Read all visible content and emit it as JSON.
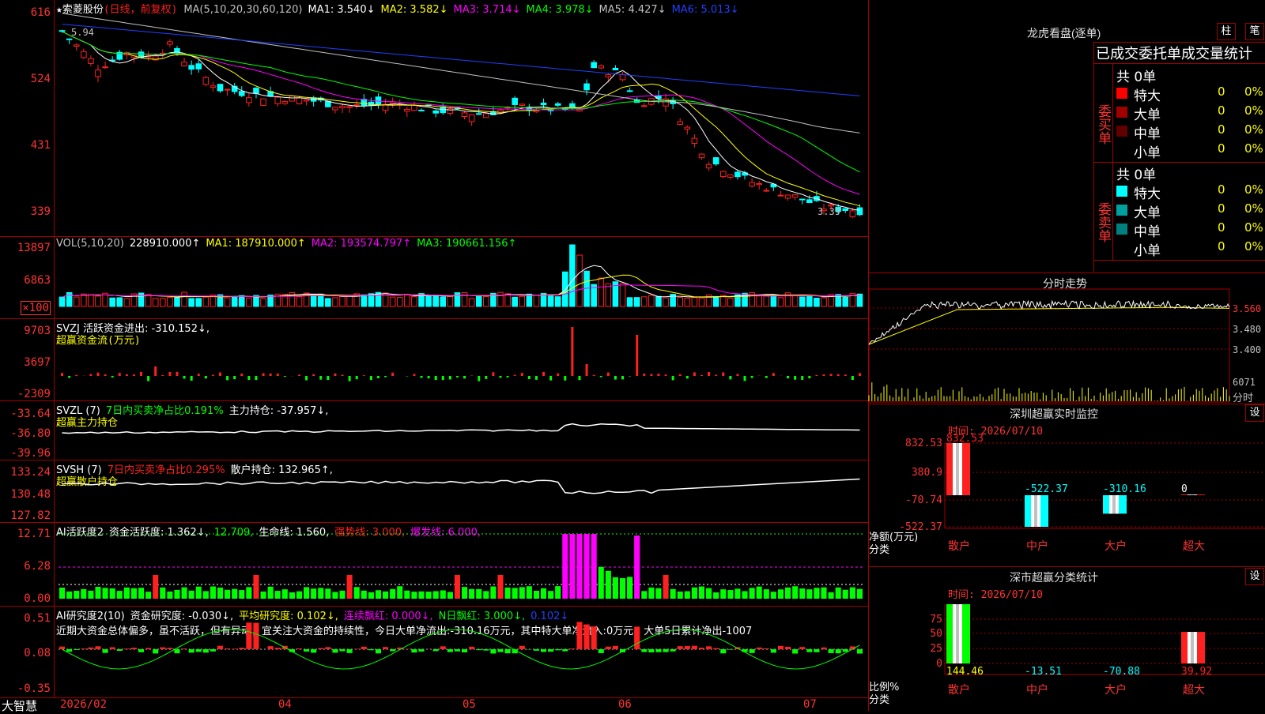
{
  "stock": {
    "name": "★索菱股份",
    "period": "(日线，前复权)",
    "bottom_brand": "大智慧"
  },
  "colors": {
    "up": "#ff2020",
    "down": "#00ffff",
    "ma1": "#ffffff",
    "ma2": "#ffff00",
    "ma3": "#ff00ff",
    "ma4": "#00ff00",
    "ma5": "#c0c0c0",
    "ma6": "#2040ff",
    "axis_text": "#ff3333",
    "border": "#a00000"
  },
  "kline": {
    "header": [
      {
        "text": "MA(5,10,20,30,60,120)",
        "color": "#c0c0c0"
      },
      {
        "text": "MA1: 3.540↓",
        "color": "#ffffff"
      },
      {
        "text": "MA2: 3.582↓",
        "color": "#ffff00"
      },
      {
        "text": "MA3: 3.714↓",
        "color": "#ff00ff"
      },
      {
        "text": "MA4: 3.978↓",
        "color": "#00ff00"
      },
      {
        "text": "MA5: 4.427↓",
        "color": "#c0c0c0"
      },
      {
        "text": "MA6: 5.013↓",
        "color": "#2040ff"
      }
    ],
    "y_ticks": [
      "616",
      "524",
      "431",
      "339"
    ],
    "high_label": "5.94",
    "low_label": "3.39"
  },
  "vol": {
    "header": [
      {
        "text": "VOL(5,10,20)",
        "color": "#c0c0c0"
      },
      {
        "text": "228910.000↑",
        "color": "#ffffff"
      },
      {
        "text": "MA1: 187910.000↑",
        "color": "#ffff00"
      },
      {
        "text": "MA2: 193574.797↑",
        "color": "#ff00ff"
      },
      {
        "text": "MA3: 190661.156↑",
        "color": "#00ff00"
      }
    ],
    "y_ticks": [
      "13897",
      "6863",
      "×100"
    ]
  },
  "svzj": {
    "header": [
      {
        "text": "SVZJ  活跃资金进出: -310.152↓,",
        "color": "#ffffff"
      }
    ],
    "subtitle": "超赢资金流(万元)",
    "y_ticks": [
      "9703",
      "3697",
      "-2309"
    ]
  },
  "svzl": {
    "header": [
      {
        "text": "SVZL (7)",
        "color": "#ffffff"
      },
      {
        "text": "7日内买卖净占比0.191%",
        "color": "#00ff00"
      },
      {
        "text": "主力持仓: -37.957↓,",
        "color": "#ffffff"
      }
    ],
    "subtitle": "超赢主力持仓",
    "y_ticks": [
      "-33.64",
      "-36.80",
      "-39.96"
    ]
  },
  "svsh": {
    "header": [
      {
        "text": "SVSH (7)",
        "color": "#ffffff"
      },
      {
        "text": "7日内买卖净占比0.295%",
        "color": "#ff2020"
      },
      {
        "text": "散户持仓: 132.965↑,",
        "color": "#ffffff"
      }
    ],
    "subtitle": "超赢散户持仓",
    "y_ticks": [
      "133.24",
      "130.48",
      "127.82"
    ]
  },
  "ai_active": {
    "header": [
      {
        "text": "AI活跃度2",
        "color": "#ffffff"
      },
      {
        "text": "资金活跃度: 1.362↓,",
        "color": "#ffffff"
      },
      {
        "text": "12.709,",
        "color": "#00ff00"
      },
      {
        "text": "生命线: 1.560,",
        "color": "#ffffff"
      },
      {
        "text": "强势线: 3.000,",
        "color": "#ff2020"
      },
      {
        "text": "爆发线: 6.000,",
        "color": "#ff00ff"
      }
    ],
    "y_ticks": [
      "12.71",
      "6.28",
      "0.00"
    ]
  },
  "ai_research": {
    "header": [
      {
        "text": "AI研究度2(10)",
        "color": "#ffffff"
      },
      {
        "text": "资金研究度: -0.030↓,",
        "color": "#ffffff"
      },
      {
        "text": "平均研究度: 0.102↓,",
        "color": "#ffff00"
      },
      {
        "text": "连续飘红: 0.000↓,",
        "color": "#ff00ff"
      },
      {
        "text": "N日飘红: 3.000↓,",
        "color": "#00ff00"
      },
      {
        "text": "0.102↓",
        "color": "#2040ff"
      }
    ],
    "comment": "近期大资金总体偏多，虽不活跃，但有异动，宜关注大资金的持续性，今日大单净流出:-310.16万元，其中特大单净流入:0万元，大单5日累计净出-1007",
    "y_ticks": [
      "0.51",
      "0.08",
      "-0.35"
    ]
  },
  "date_axis": [
    "2026/02",
    "04",
    "05",
    "06",
    "07"
  ],
  "dragon_tiger": {
    "title": "龙虎看盘(逐单)",
    "btn_zhu": "柱",
    "btn_bi": "笔",
    "subtitle": "已成交委托单成交量统计",
    "buy_label": "委买单",
    "sell_label": "委卖单",
    "buy_total": "共 0单",
    "sell_total": "共 0单",
    "buy_rows": [
      {
        "label": "特大",
        "count": "0",
        "pct": "0%",
        "color": "#ff0000"
      },
      {
        "label": "大单",
        "count": "0",
        "pct": "0%",
        "color": "#a00000"
      },
      {
        "label": "中单",
        "count": "0",
        "pct": "0%",
        "color": "#600000"
      },
      {
        "label": "小单",
        "count": "0",
        "pct": "0%",
        "color": ""
      }
    ],
    "sell_rows": [
      {
        "label": "特大",
        "count": "0",
        "pct": "0%",
        "color": "#00ffff"
      },
      {
        "label": "大单",
        "count": "0",
        "pct": "0%",
        "color": "#00a0a0"
      },
      {
        "label": "中单",
        "count": "0",
        "pct": "0%",
        "color": "#008080"
      },
      {
        "label": "小单",
        "count": "0",
        "pct": "0%",
        "color": ""
      }
    ]
  },
  "intraday": {
    "title": "分时走势",
    "y_ticks": [
      "3.560",
      "3.480",
      "3.400"
    ],
    "vol_ticks": [
      "6071",
      "分时"
    ]
  },
  "sz_monitor": {
    "title": "深圳超赢实时监控",
    "settings": "设",
    "time": "时间: 2026/07/10",
    "y_ticks": [
      "832.53",
      "380.9",
      "-70.74",
      "-522.37"
    ],
    "y_unit": "净额(万元)",
    "x_unit": "分类",
    "chart_data": {
      "type": "bar",
      "categories": [
        "散户",
        "中户",
        "大户",
        "超大"
      ],
      "values": [
        832.53,
        -522.37,
        -310.16,
        0
      ],
      "value_labels": [
        "832.53",
        "-522.37",
        "-310.16",
        "0"
      ],
      "ylim": [
        -522.37,
        832.53
      ]
    }
  },
  "sz_class": {
    "title": "深市超赢分类统计",
    "settings": "设",
    "time": "时间: 2026/07/10",
    "y_ticks": [
      "75",
      "50",
      "25",
      "0"
    ],
    "y_unit": "比例%",
    "x_unit": "分类",
    "chart_data": {
      "type": "bar",
      "categories": [
        "散户",
        "中户",
        "大户",
        "超大"
      ],
      "values": [
        144.46,
        -13.51,
        -70.88,
        39.92
      ],
      "value_labels": [
        "144.46",
        "-13.51",
        "-70.88",
        "39.92"
      ],
      "ylim": [
        0,
        75
      ]
    }
  }
}
